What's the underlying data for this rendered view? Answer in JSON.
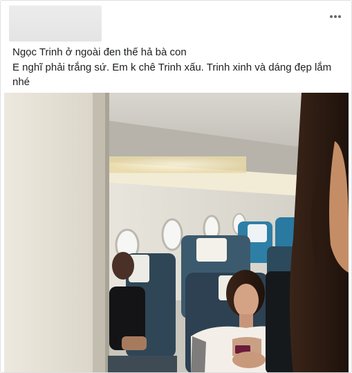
{
  "post": {
    "caption_lines": [
      "Ngọc Trinh ở ngoài đen thế hả bà con",
      "E nghĩ phải trắng sứ. Em k chê Trinh xấu. Trinh xinh và dáng đẹp lắm nhé"
    ],
    "more_icon": "more-horizontal-icon"
  },
  "photo": {
    "subject": "airplane-cabin-photo"
  }
}
